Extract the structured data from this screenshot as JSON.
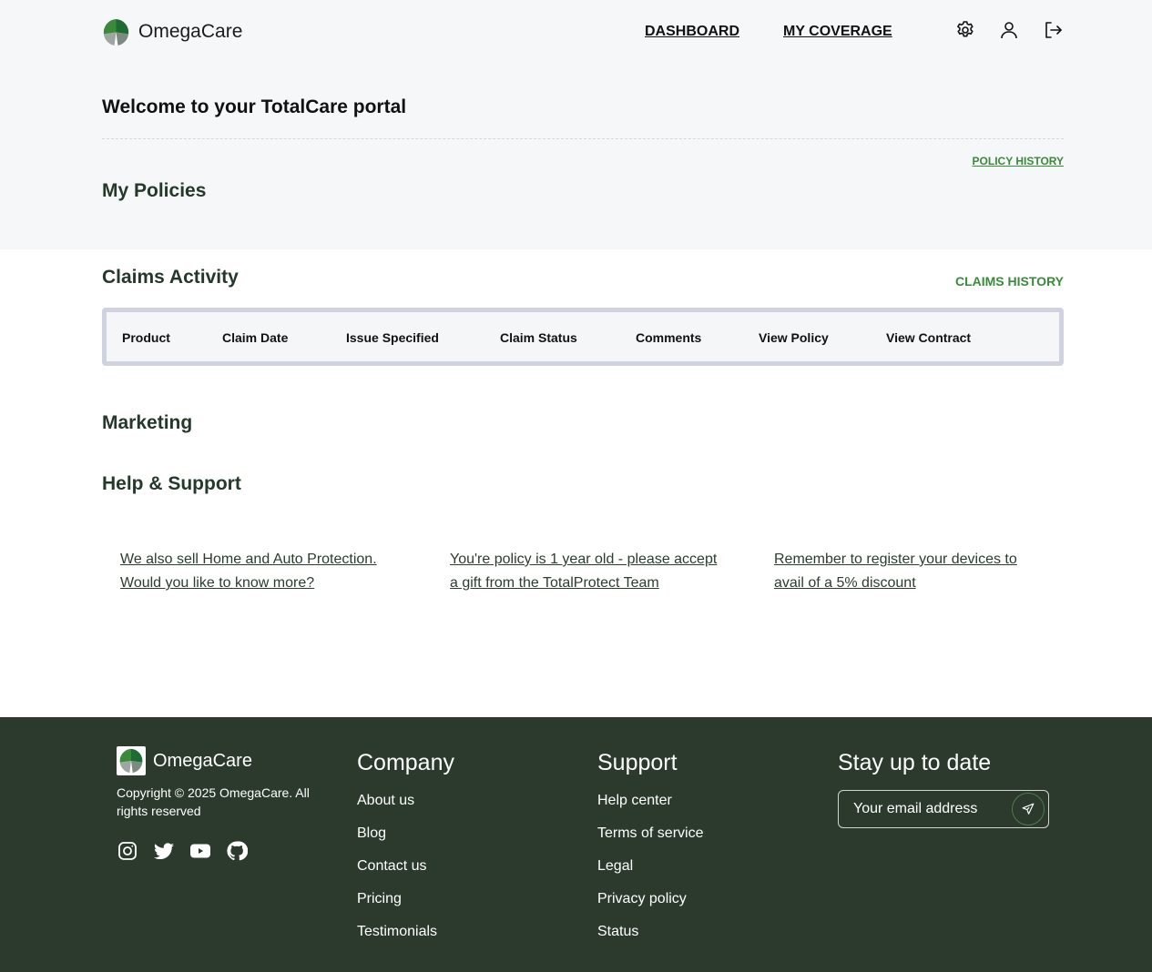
{
  "brand": {
    "name": "OmegaCare",
    "accent": "#3a8a3a",
    "footer_bg": "#2b3a2d"
  },
  "nav": {
    "dashboard": "DASHBOARD",
    "coverage": "MY COVERAGE"
  },
  "header_icons": [
    "gear-icon",
    "user-icon",
    "logout-icon"
  ],
  "welcome": "Welcome to your TotalCare portal",
  "policies": {
    "history_link": "POLICY HISTORY",
    "title": "My Policies"
  },
  "claims": {
    "title": "Claims Activity",
    "history_link": "CLAIMS HISTORY",
    "columns": [
      "Product",
      "Claim Date",
      "Issue Specified",
      "Claim Status",
      "Comments",
      "View Policy",
      "View Contract"
    ]
  },
  "sections": {
    "marketing": "Marketing",
    "help": "Help & Support"
  },
  "promos": [
    "We also sell Home and Auto Protection. Would you like to know more?",
    "You're policy is 1 year old - please accept a gift from the TotalProtect Team",
    "Remember to register your devices to avail of a 5% discount"
  ],
  "footer": {
    "brand": "OmegaCare",
    "copyright": "Copyright © 2025 OmegaCare. All rights reserved",
    "socials": [
      "instagram-icon",
      "twitter-icon",
      "youtube-icon",
      "github-icon"
    ],
    "company": {
      "title": "Company",
      "links": [
        "About us",
        "Blog",
        "Contact us",
        "Pricing",
        "Testimonials"
      ]
    },
    "support": {
      "title": "Support",
      "links": [
        "Help center",
        "Terms of service",
        "Legal",
        "Privacy policy",
        "Status"
      ]
    },
    "newsletter": {
      "title": "Stay up to date",
      "placeholder": "Your email address"
    }
  }
}
